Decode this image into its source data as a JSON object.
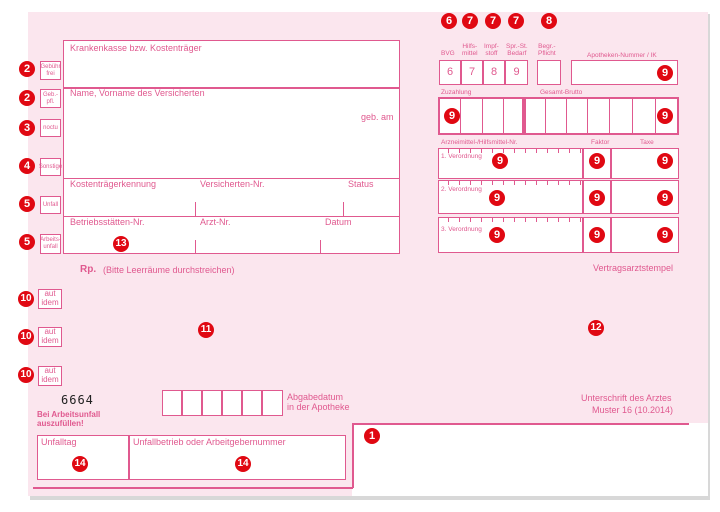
{
  "form": {
    "krankenkasse": "Krankenkasse bzw. Kostenträger",
    "name": "Name, Vorname des Versicherten",
    "geb_am": "geb. am",
    "kostentraegerkennung": "Kostenträgerkennung",
    "versicherten_nr": "Versicherten-Nr.",
    "status": "Status",
    "betriebsstaetten_nr": "Betriebsstätten-Nr.",
    "arzt_nr": "Arzt-Nr.",
    "datum": "Datum",
    "rp": "Rp.",
    "rp_hint": "(Bitte Leerräume durchstreichen)",
    "vertragsarztstempel": "Vertragsarztstempel",
    "bvg": "BVG",
    "hilfsmittel": "Hilfs-\nmittel",
    "impfstoff": "Impf-\nstoff",
    "spr_st_bedarf": "Spr.-St.\nBedarf",
    "begr_pflicht": "Begr.-\nPflicht",
    "apotheken_nr": "Apotheken-Nummer / IK",
    "digit_bvg": "6",
    "digit_hilfs": "7",
    "digit_impf": "8",
    "digit_spr": "9",
    "zuzahlung": "Zuzahlung",
    "gesamt_brutto": "Gesamt-Brutto",
    "arzneimittel_nr": "Arzneimittel-/Hilfsmittel-Nr.",
    "faktor": "Faktor",
    "taxe": "Taxe",
    "verordnung_1": "1. Verordnung",
    "verordnung_2": "2. Verordnung",
    "verordnung_3": "3. Verordnung",
    "abgabedatum": "Abgabedatum\nin der Apotheke",
    "unterschrift": "Unterschrift des Arztes",
    "muster": "Muster 16 (10.2014)",
    "code_mark": "6664",
    "arbeitsunfall": "Bei Arbeitsunfall\nauszufüllen!",
    "unfalltag": "Unfalltag",
    "unfallbetrieb": "Unfallbetrieb oder Arbeitgebernummer"
  },
  "side_buttons": {
    "gebuehr_frei": "Gebühr\nfrei",
    "geb_pfl": "Geb.-\npfl.",
    "noctu": "noctu",
    "sonstige": "Sonstige",
    "unfall": "Unfall",
    "arbeitsunfall": "Arbeits-\nunfall",
    "aut_idem_1": "aut\nidem",
    "aut_idem_2": "aut\nidem",
    "aut_idem_3": "aut\nidem"
  },
  "markers": {
    "m1": "1",
    "m2a": "2",
    "m2b": "2",
    "m3": "3",
    "m4": "4",
    "m5a": "5",
    "m5b": "5",
    "m6": "6",
    "m7a": "7",
    "m7b": "7",
    "m7c": "7",
    "m8": "8",
    "m9_apo": "9",
    "m9_zuz": "9",
    "m9_brutto": "9",
    "m9_v1": "9",
    "m9_v1f": "9",
    "m9_v1t": "9",
    "m9_v2": "9",
    "m9_v2f": "9",
    "m9_v2t": "9",
    "m9_v3": "9",
    "m9_v3f": "9",
    "m9_v3t": "9",
    "m10a": "10",
    "m10b": "10",
    "m10c": "10",
    "m11": "11",
    "m12": "12",
    "m13": "13",
    "m14a": "14",
    "m14b": "14"
  },
  "colors": {
    "form_bg": "#fbe6ee",
    "line": "#e0598f",
    "marker": "#e00812"
  }
}
